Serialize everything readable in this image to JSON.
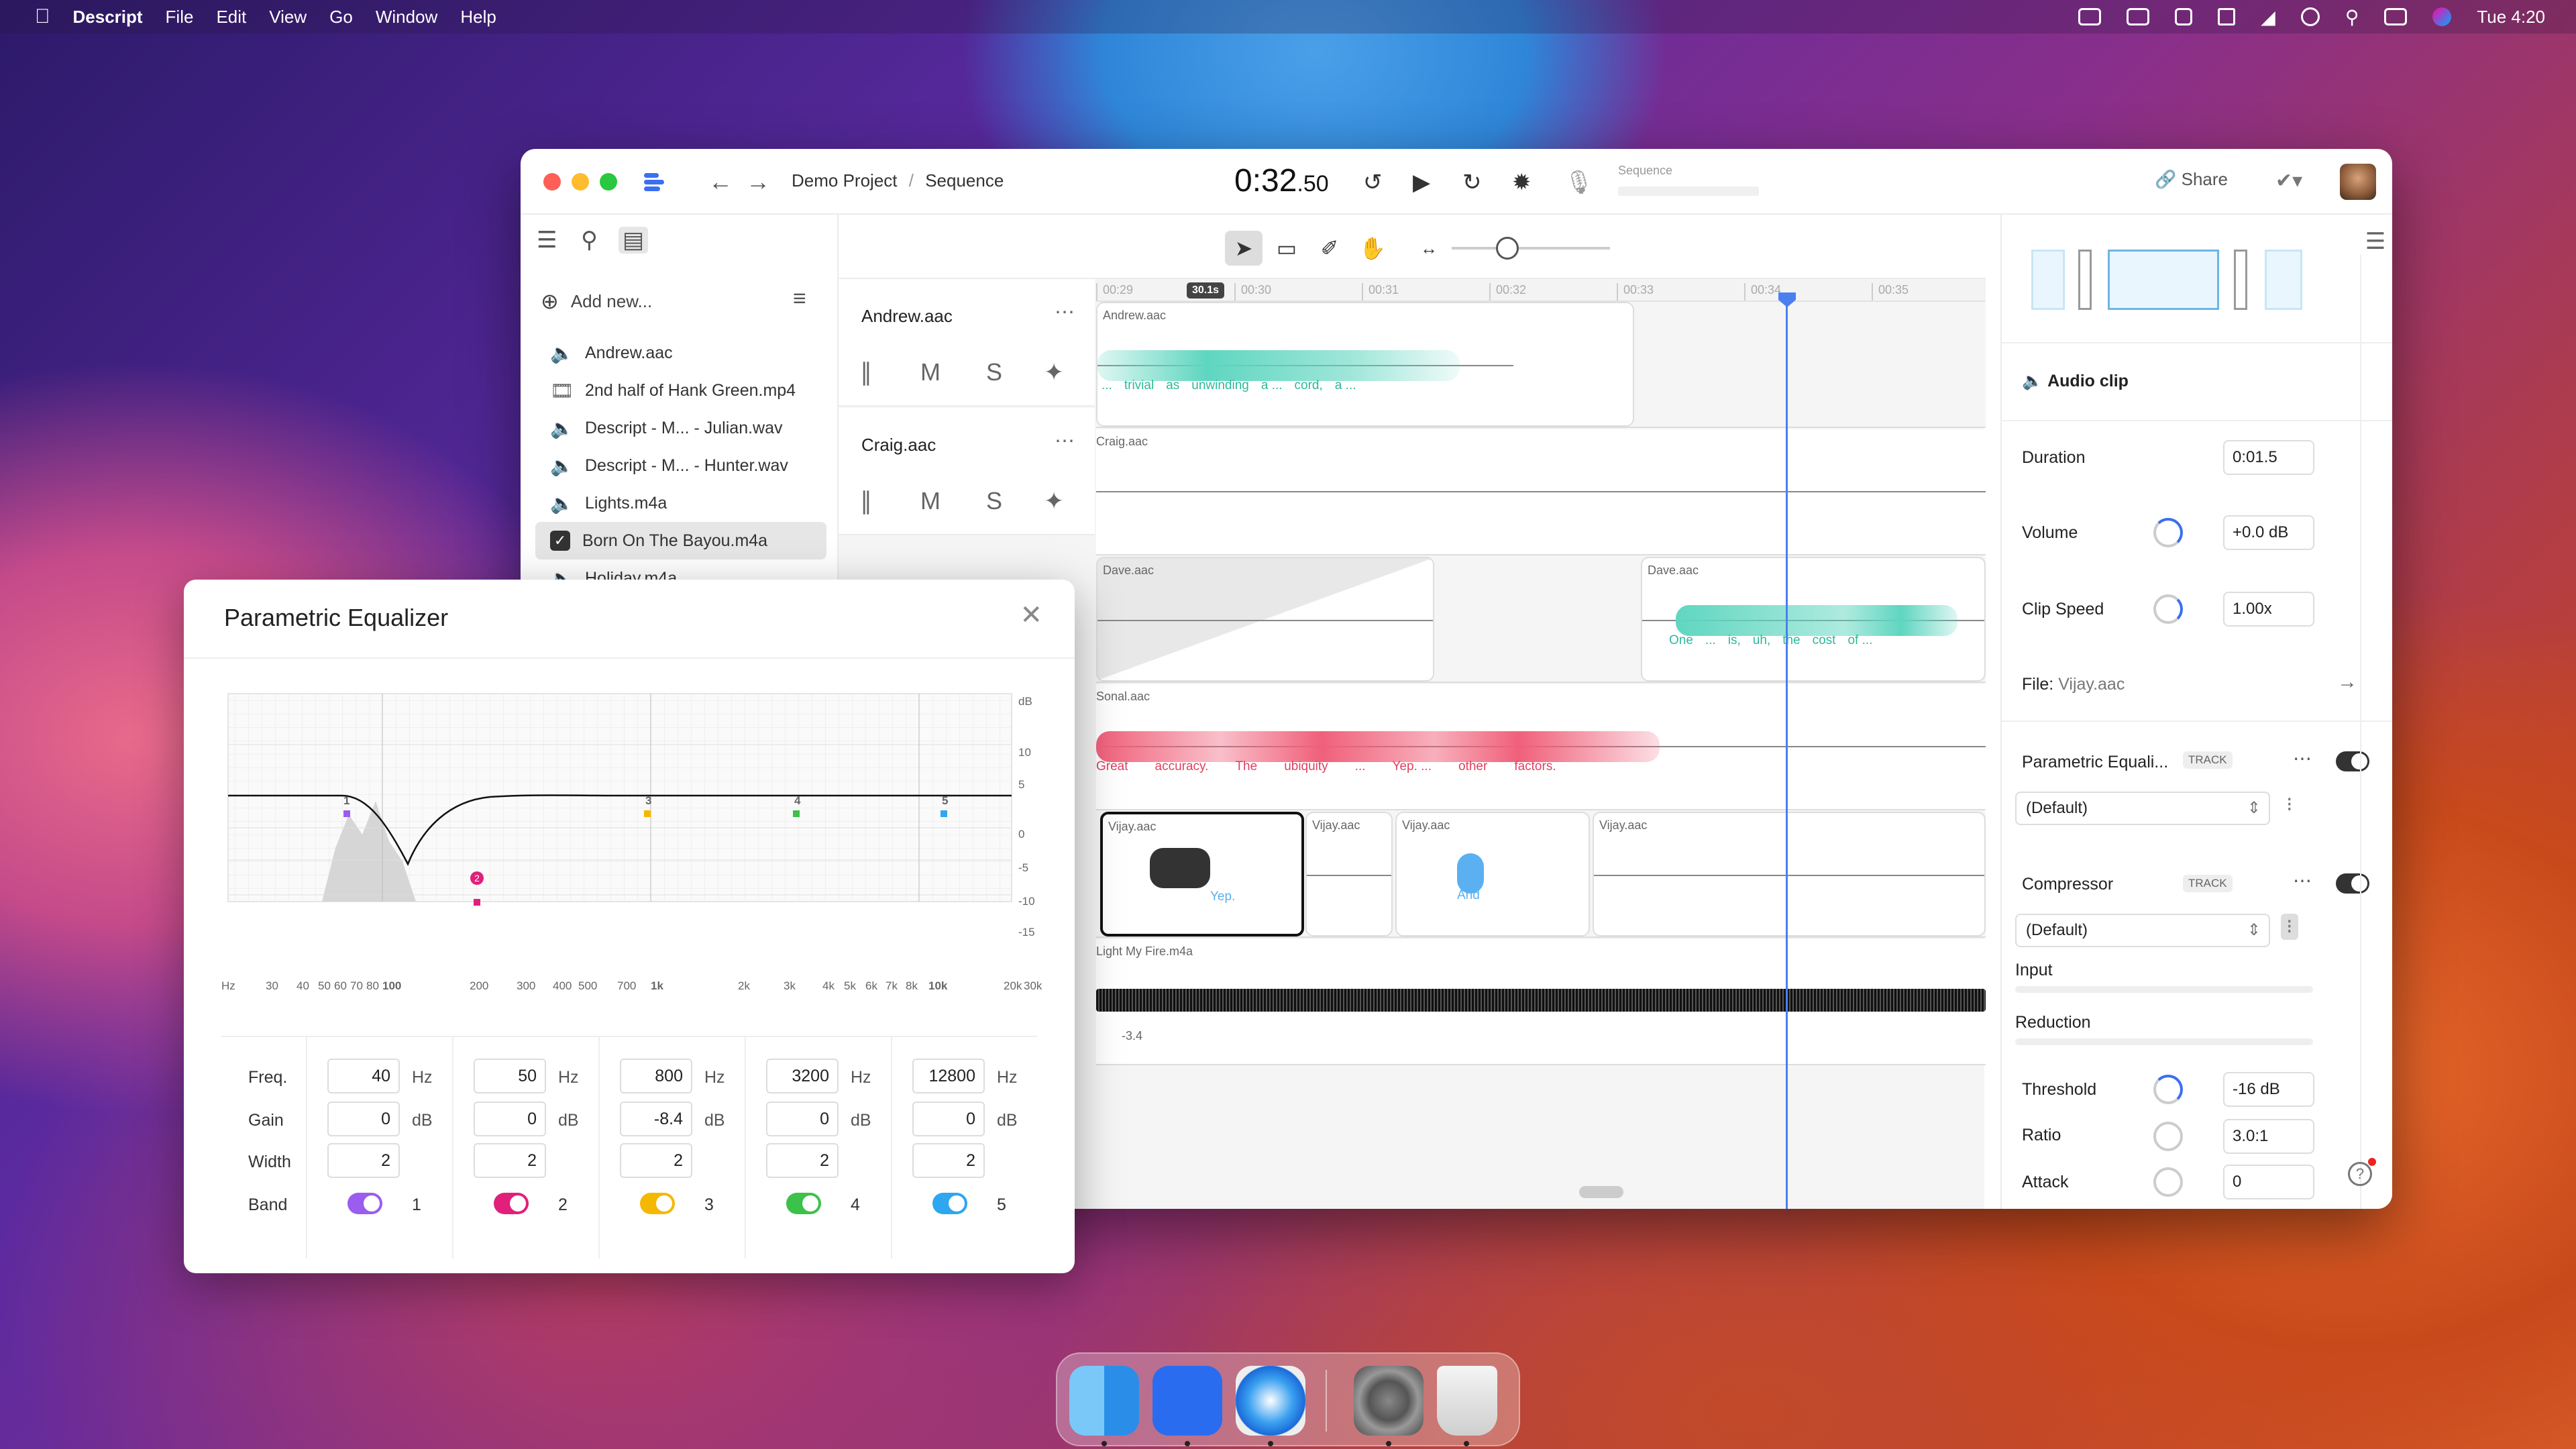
{
  "menubar": {
    "app": "Descript",
    "items": [
      "File",
      "Edit",
      "View",
      "Go",
      "Window",
      "Help"
    ],
    "clock": "Tue 4:20"
  },
  "window": {
    "breadcrumb_project": "Demo Project",
    "breadcrumb_sep": "/",
    "breadcrumb_sequence": "Sequence",
    "timecode_main": "0:32",
    "timecode_frac": ".50",
    "sequence_label": "Sequence",
    "share": "Share"
  },
  "sidebar": {
    "add_new": "Add new...",
    "files": [
      {
        "name": "Andrew.aac",
        "icon": "speaker-icon"
      },
      {
        "name": "2nd half of Hank Green.mp4",
        "icon": "film-icon"
      },
      {
        "name": "Descript - M... - Julian.wav",
        "icon": "speaker-icon"
      },
      {
        "name": "Descript - M... - Hunter.wav",
        "icon": "speaker-icon"
      },
      {
        "name": "Lights.m4a",
        "icon": "speaker-icon"
      },
      {
        "name": "Born On The Bayou.m4a",
        "icon": "checkbox-icon",
        "selected": true
      },
      {
        "name": "Holiday.m4a",
        "icon": "speaker-icon"
      }
    ]
  },
  "ruler": {
    "badge": "30.1s",
    "ticks": [
      "00:29",
      "00:30",
      "00:31",
      "00:32",
      "00:33",
      "00:34",
      "00:35"
    ]
  },
  "tracks": [
    {
      "name": "Andrew.aac",
      "m": "M",
      "s": "S"
    },
    {
      "name": "Craig.aac",
      "m": "M",
      "s": "S"
    }
  ],
  "lanes": {
    "andrew": {
      "clip": "Andrew.aac",
      "words": [
        "...",
        "trivial",
        "as",
        "unwinding",
        "a ...",
        "cord,",
        "a ..."
      ]
    },
    "craig": {
      "clip": "Craig.aac"
    },
    "dave": {
      "clip1": "Dave.aac",
      "clip2": "Dave.aac",
      "words": [
        "One",
        "...",
        "is,",
        "uh,",
        "the",
        "cost",
        "of ..."
      ]
    },
    "sonal": {
      "clip": "Sonal.aac",
      "words": [
        "Great",
        "accuracy.",
        "The",
        "ubiquity",
        "...",
        "Yep. ...",
        "other",
        "factors."
      ]
    },
    "vijay": {
      "clips": [
        "Vijay.aac",
        "Vijay.aac",
        "Vijay.aac",
        "Vijay.aac"
      ],
      "word1": "Yep.",
      "word2": "And"
    },
    "light": {
      "clip": "Light My Fire.m4a",
      "level": "-3.4"
    }
  },
  "inspector": {
    "section": "Audio clip",
    "duration_label": "Duration",
    "duration": "0:01.5",
    "volume_label": "Volume",
    "volume": "+0.0 dB",
    "speed_label": "Clip Speed",
    "speed": "1.00x",
    "file_label": "File:",
    "file": "Vijay.aac",
    "eq_label": "Parametric Equali...",
    "eq_badge": "TRACK",
    "eq_preset": "(Default)",
    "comp_label": "Compressor",
    "comp_badge": "TRACK",
    "comp_preset": "(Default)",
    "input_label": "Input",
    "reduction_label": "Reduction",
    "threshold_label": "Threshold",
    "threshold": "-16 dB",
    "ratio_label": "Ratio",
    "ratio": "3.0:1",
    "attack_label": "Attack",
    "attack": "0"
  },
  "equalizer": {
    "title": "Parametric Equalizer",
    "y_unit": "dB",
    "y_ticks": [
      "10",
      "5",
      "0",
      "-5",
      "-10",
      "-15"
    ],
    "x_ticks": [
      "Hz",
      "30",
      "40",
      "50",
      "60",
      "70",
      "80",
      "100",
      "200",
      "300",
      "400",
      "500",
      "700",
      "1k",
      "2k",
      "3k",
      "4k",
      "5k",
      "6k",
      "7k",
      "8k",
      "10k",
      "20k",
      "30k"
    ],
    "row_labels": {
      "freq": "Freq.",
      "gain": "Gain",
      "width": "Width",
      "band": "Band"
    },
    "units": {
      "freq": "Hz",
      "gain": "dB"
    },
    "bands": [
      {
        "n": "1",
        "freq": "40",
        "gain": "0",
        "width": "2",
        "color": "#9b5cf0"
      },
      {
        "n": "2",
        "freq": "50",
        "gain": "0",
        "width": "2",
        "color": "#e0207a"
      },
      {
        "n": "3",
        "freq": "800",
        "gain": "-8.4",
        "width": "2",
        "color": "#f5b800"
      },
      {
        "n": "4",
        "freq": "3200",
        "gain": "0",
        "width": "2",
        "color": "#3cc14a"
      },
      {
        "n": "5",
        "freq": "12800",
        "gain": "0",
        "width": "2",
        "color": "#2ea6f0"
      }
    ],
    "markers": [
      "1",
      "2",
      "3",
      "4",
      "5"
    ]
  },
  "colors": {
    "accent": "#3a6ff0",
    "andrew": "#5fd6c0",
    "sonal": "#f0607a",
    "dave": "#5fd6c0",
    "vijay": "#5ab0f0"
  },
  "dock": [
    "finder-icon",
    "descript-icon",
    "safari-icon",
    "system-settings-icon",
    "trash-icon"
  ]
}
